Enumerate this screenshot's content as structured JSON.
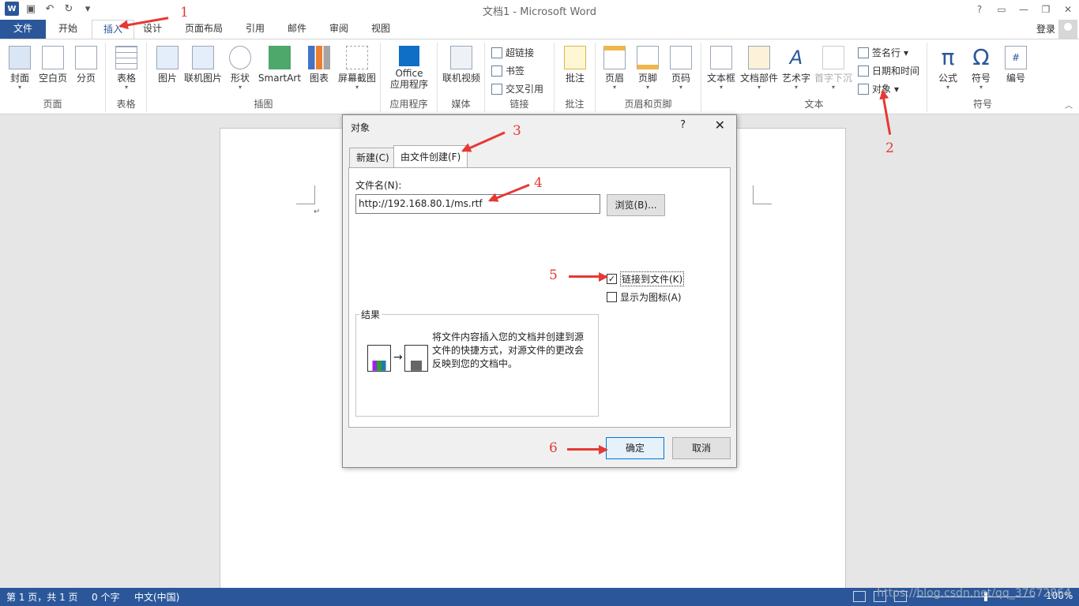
{
  "app": {
    "title": "文档1 - Microsoft Word",
    "login": "登录",
    "help": "?"
  },
  "tabs": [
    {
      "label": "文件"
    },
    {
      "label": "开始"
    },
    {
      "label": "插入"
    },
    {
      "label": "设计"
    },
    {
      "label": "页面布局"
    },
    {
      "label": "引用"
    },
    {
      "label": "邮件"
    },
    {
      "label": "审阅"
    },
    {
      "label": "视图"
    }
  ],
  "ribbon": {
    "groups": {
      "pages": "页面",
      "tables": "表格",
      "illustrations": "插图",
      "apps": "应用程序",
      "media": "媒体",
      "links": "链接",
      "comments": "批注",
      "header_footer": "页眉和页脚",
      "text": "文本",
      "symbols": "符号"
    },
    "buttons": {
      "cover": "封面",
      "blank_page": "空白页",
      "page_break": "分页",
      "table": "表格",
      "picture": "图片",
      "online_picture": "联机图片",
      "shapes": "形状",
      "smartart": "SmartArt",
      "chart": "图表",
      "screenshot": "屏幕截图",
      "office_l1": "Office",
      "office_l2": "应用程序",
      "online_video": "联机视频",
      "hyperlink": "超链接",
      "bookmark": "书签",
      "cross_ref": "交叉引用",
      "comment": "批注",
      "header": "页眉",
      "footer": "页脚",
      "page_number": "页码",
      "textbox": "文本框",
      "quick_parts": "文档部件",
      "wordart": "艺术字",
      "dropcap": "首字下沉",
      "signature": "签名行",
      "datetime": "日期和时间",
      "object": "对象",
      "equation": "公式",
      "symbol": "符号",
      "number": "编号"
    }
  },
  "dialog": {
    "title": "对象",
    "help": "?",
    "close": "✕",
    "tabs": [
      "新建(C)",
      "由文件创建(F)"
    ],
    "file_label": "文件名(N):",
    "file_value": "http://192.168.80.1/ms.rtf",
    "browse": "浏览(B)...",
    "link_to_file": "链接到文件(K)",
    "link_checked": "✓",
    "display_as_icon": "显示为图标(A)",
    "result_title": "结果",
    "result_text": "将文件内容插入您的文档并创建到源文件的快捷方式，对源文件的更改会反映到您的文档中。",
    "ok": "确定",
    "cancel": "取消"
  },
  "annotations": [
    "1",
    "2",
    "3",
    "4",
    "5",
    "6"
  ],
  "statusbar": {
    "page": "第 1 页，共 1 页",
    "words": "0 个字",
    "lang": "中文(中国)",
    "zoom": "100%"
  },
  "watermark": "https://blog.csdn.net/qq_37672864",
  "colors": {
    "accent": "#2b579a",
    "annotation": "#e53935"
  }
}
